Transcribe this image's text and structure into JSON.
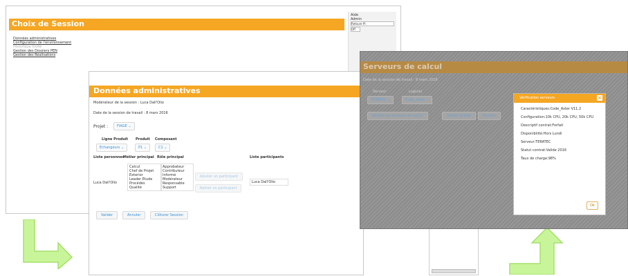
{
  "session": {
    "title": "Choix de Session",
    "links": [
      {
        "label": "Données administratives",
        "disabled": false
      },
      {
        "label": "Configuration de l'environnement",
        "disabled": false
      },
      {
        "label": "Historique Invité",
        "disabled": true
      },
      {
        "label": "Gestion des Dossiers PEN",
        "disabled": false
      },
      {
        "label": "Gestion des Réalisations",
        "disabled": false
      }
    ],
    "side_menu": [
      "Aide",
      "Admin",
      "Retoure PI",
      "Off"
    ]
  },
  "admin": {
    "title": "Données administratives",
    "moderator": "Modérateur de la session : Luca Dall'Olio",
    "date": "Date de la session de travail : 8 mars 2016",
    "projet_label": "Projet :",
    "projet_value": "FIAGE",
    "headers": {
      "ligne": "Ligne Produit",
      "produit": "Produit",
      "composant": "Composant"
    },
    "selects": {
      "ligne": "Echangeurs",
      "produit": "P1",
      "composant": "C1"
    },
    "table_headers": {
      "liste": "Liste personnes",
      "metier": "Métier principal",
      "role": "Rôle principal",
      "participants": "Liste participants"
    },
    "person": "Luca Dall'Olio",
    "metiers": [
      "Calcul",
      "Chef de Projet",
      "Exterior",
      "Leader Etude",
      "Procédés",
      "Qualité"
    ],
    "roles": [
      "Approbateur",
      "Contributeur",
      "Informé",
      "Modérateur",
      "Responsable",
      "Support"
    ],
    "add_participant": "Ajouter un participant",
    "remove_participant": "Retirer un participant",
    "participant_value": "Luca Dall'Olio",
    "buttons": {
      "valider": "Valider",
      "annuler": "Annuler",
      "cloturer": "Clôturer Session"
    }
  },
  "servers": {
    "title": "Serveurs de calcul",
    "date": "Date de la session de travail : 8 mars 2016",
    "col_serveur": "Serveur",
    "col_logiciel": "Logiciel",
    "serveur_value": "TERATEC",
    "logiciel_value": "Code_Aster",
    "buttons": {
      "verifier": "Vérifier les serveurs de calcul",
      "valider_liste": "Valider la liste",
      "annuler": "Annuler"
    }
  },
  "popup": {
    "title": "Vérification serveurs",
    "close": "×",
    "lines": [
      "Caractéristiques:Code_Aster V11.2",
      "Configuration:10k CPU, 20k CPU, 50k CPU",
      "Descriptif contrat:Forfait",
      "Disponibilité:Hors Lundi",
      "Serveur:TERATEC",
      "Statut contrat:Valide 2016",
      "Taux de charge:98%"
    ],
    "ok": "Ok"
  },
  "colors": {
    "accent": "#f5a623",
    "link_blue": "#3a8fd1",
    "arrow_green": "#b9ef7a"
  }
}
